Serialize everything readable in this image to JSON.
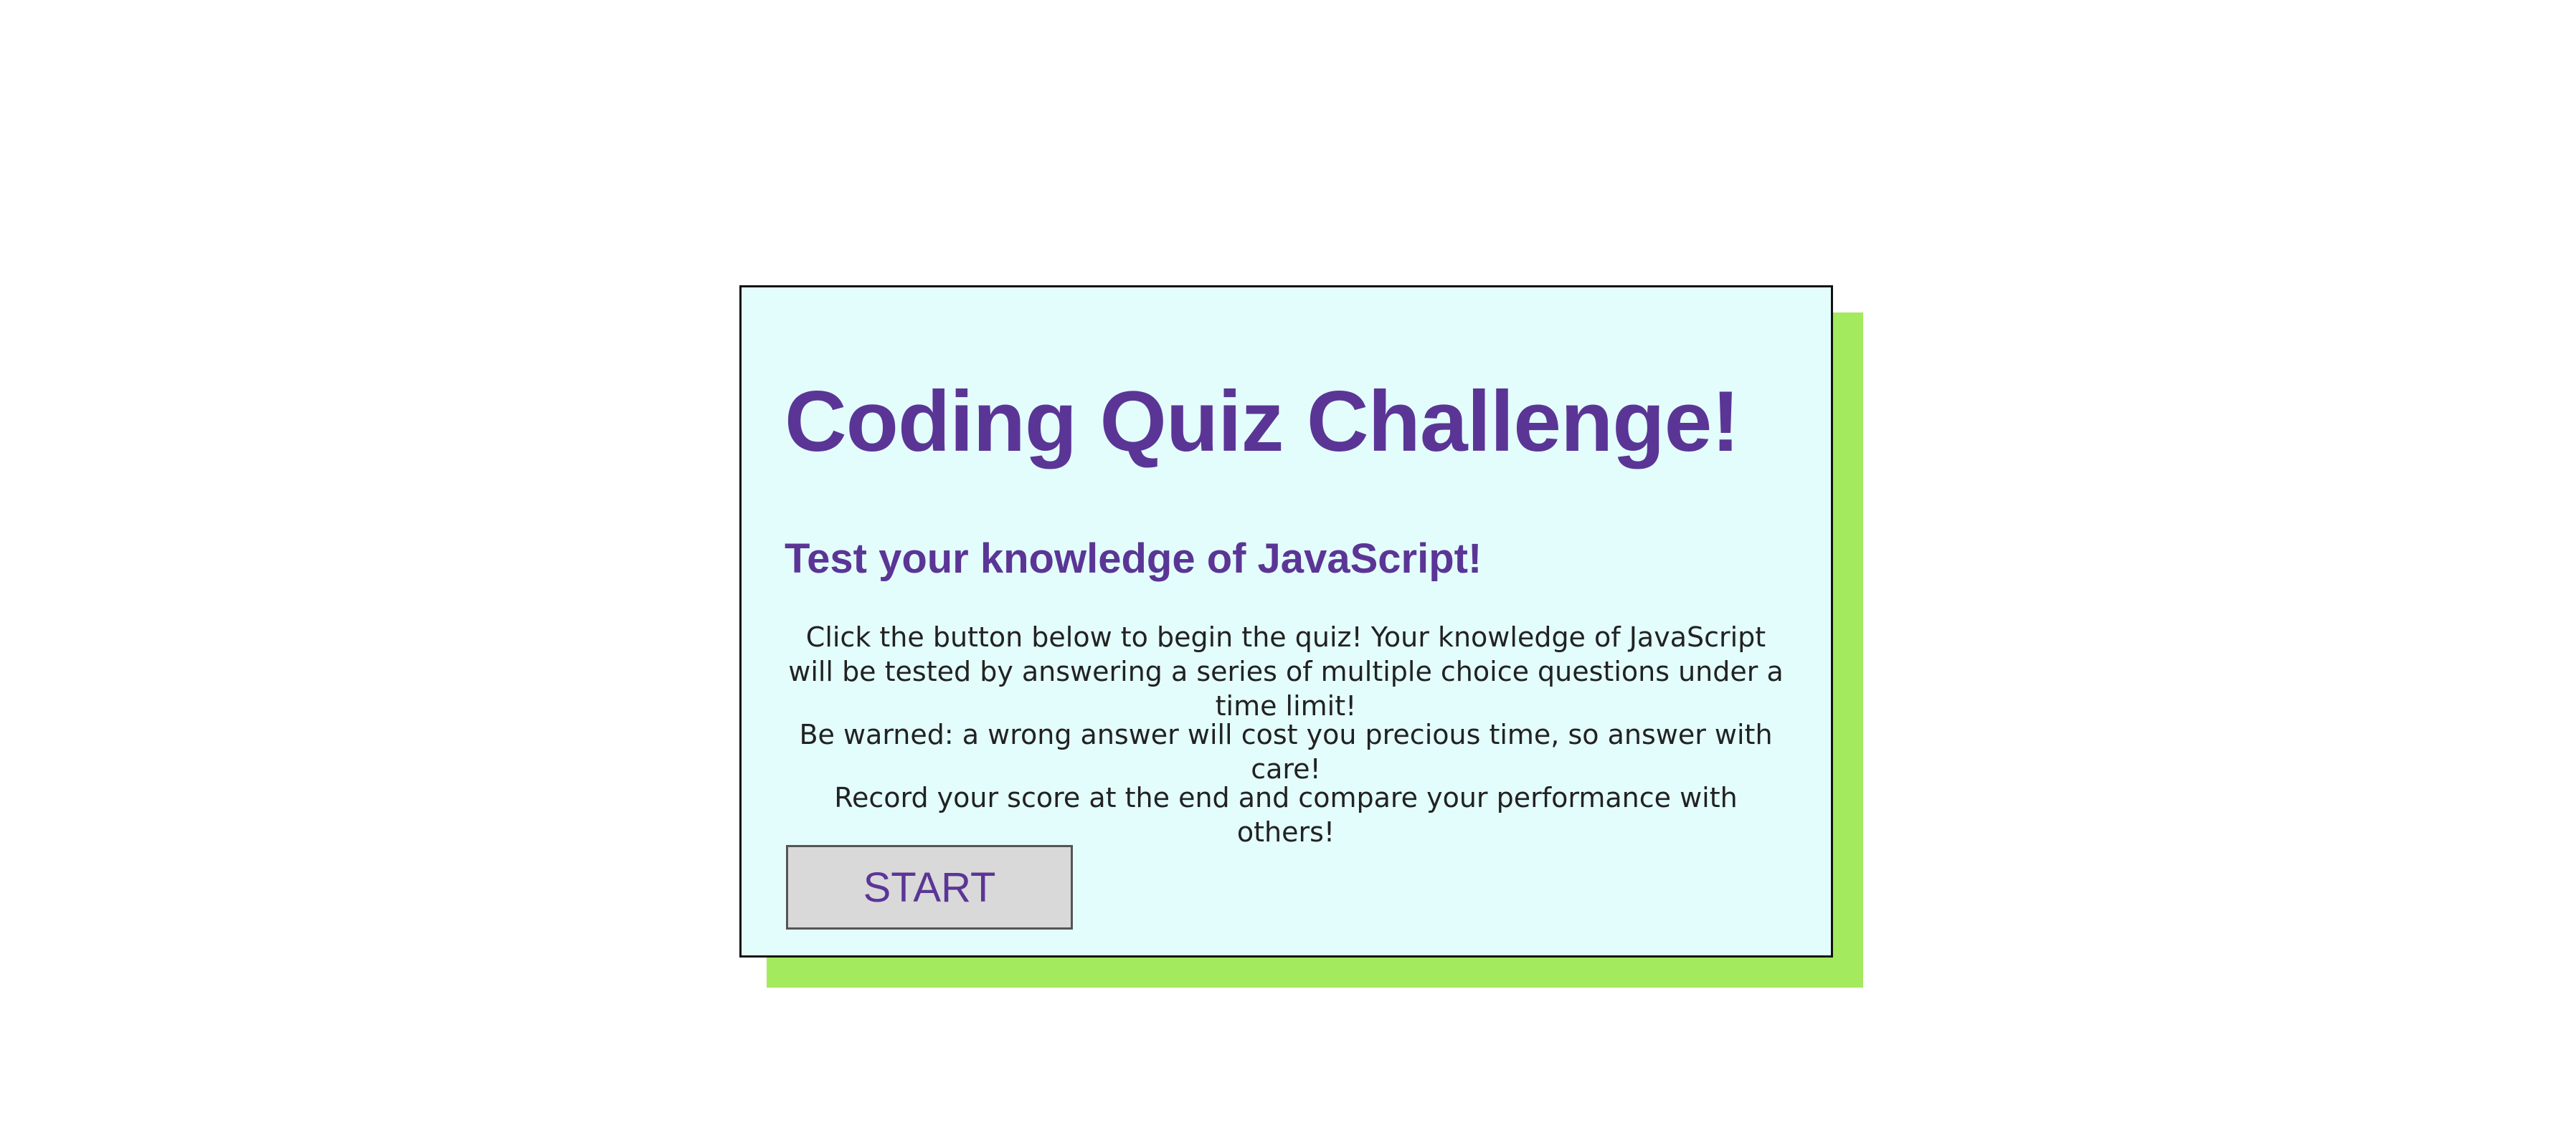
{
  "quiz": {
    "title": "Coding Quiz Challenge!",
    "subtitle": "Test your knowledge of JavaScript!",
    "paragraphs": [
      "Click the button below to begin the quiz! Your knowledge of JavaScript will be tested by answering a series of multiple choice questions under a time limit!",
      "Be warned: a wrong answer will cost you precious time, so answer with care!",
      "Record your score at the end and compare your performance with others!"
    ],
    "start_label": "START"
  },
  "colors": {
    "accent_text": "#5b3596",
    "card_background": "#e3fdfc",
    "shadow": "#a3ea5e",
    "button_background": "#d9d9d9"
  }
}
